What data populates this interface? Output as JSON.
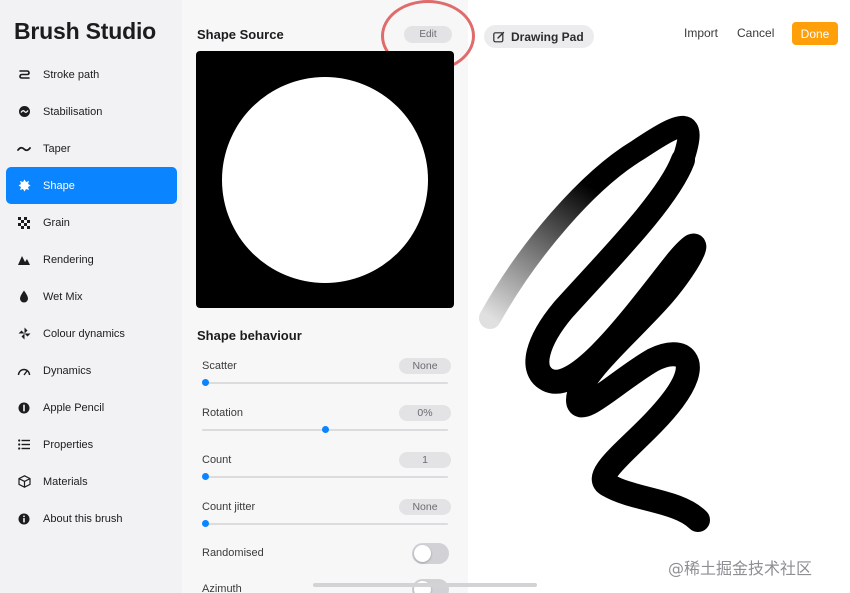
{
  "app_title": "Brush Studio",
  "sidebar": {
    "items": [
      {
        "label": "Stroke path",
        "icon": "stroke-path-icon"
      },
      {
        "label": "Stabilisation",
        "icon": "stabilisation-icon"
      },
      {
        "label": "Taper",
        "icon": "taper-icon"
      },
      {
        "label": "Shape",
        "icon": "shape-icon",
        "active": true
      },
      {
        "label": "Grain",
        "icon": "grain-icon"
      },
      {
        "label": "Rendering",
        "icon": "rendering-icon"
      },
      {
        "label": "Wet Mix",
        "icon": "wet-mix-icon"
      },
      {
        "label": "Colour dynamics",
        "icon": "colour-dynamics-icon"
      },
      {
        "label": "Dynamics",
        "icon": "dynamics-icon"
      },
      {
        "label": "Apple Pencil",
        "icon": "apple-pencil-icon"
      },
      {
        "label": "Properties",
        "icon": "properties-icon"
      },
      {
        "label": "Materials",
        "icon": "materials-icon"
      },
      {
        "label": "About this brush",
        "icon": "about-icon"
      }
    ]
  },
  "shape_source": {
    "title": "Shape Source",
    "edit_label": "Edit"
  },
  "shape_behaviour": {
    "title": "Shape behaviour",
    "scatter": {
      "label": "Scatter",
      "value": "None",
      "level": 0.0
    },
    "rotation": {
      "label": "Rotation",
      "value": "0%",
      "level": 0.5
    },
    "count": {
      "label": "Count",
      "value": "1",
      "level": 0.0
    },
    "count_jitter": {
      "label": "Count jitter",
      "value": "None",
      "level": 0.0
    },
    "randomised": {
      "label": "Randomised",
      "on": false
    },
    "azimuth": {
      "label": "Azimuth",
      "on": false
    }
  },
  "drawing_pad": {
    "label": "Drawing Pad",
    "icon": "edit-icon"
  },
  "header_actions": {
    "import": "Import",
    "cancel": "Cancel",
    "done": "Done"
  },
  "colors": {
    "accent": "#0a84ff",
    "done": "#ff9f0a",
    "highlight": "#e06b6b"
  },
  "watermark": "@稀土掘金技术社区"
}
